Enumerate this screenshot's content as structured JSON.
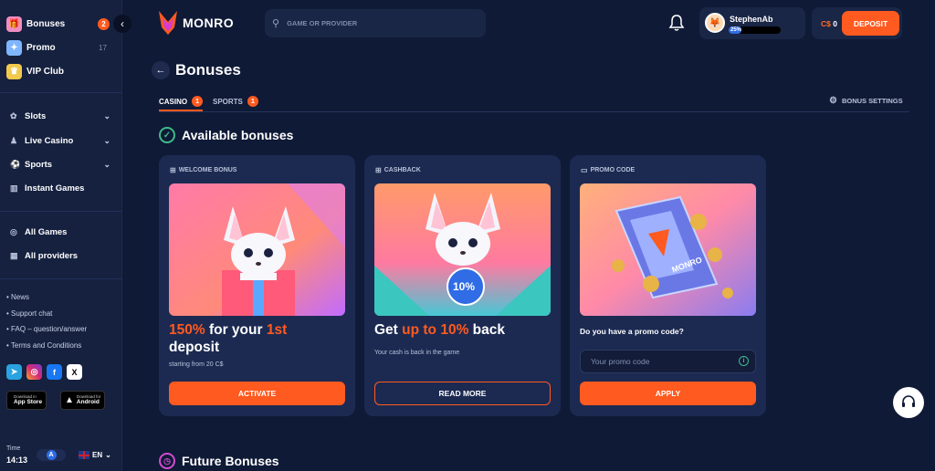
{
  "sidebar": {
    "top_items": [
      {
        "label": "Bonuses",
        "badge": "2",
        "icon": "gift-icon"
      },
      {
        "label": "Promo",
        "count": "17",
        "icon": "promo-icon"
      },
      {
        "label": "VIP Club",
        "icon": "crown-icon"
      }
    ],
    "nav": [
      {
        "label": "Slots",
        "icon": "slots-icon"
      },
      {
        "label": "Live Casino",
        "icon": "live-casino-icon"
      },
      {
        "label": "Sports",
        "icon": "sports-icon"
      },
      {
        "label": "Instant Games",
        "icon": "instant-games-icon"
      }
    ],
    "nav2": [
      {
        "label": "All Games",
        "icon": "all-games-icon"
      },
      {
        "label": "All providers",
        "icon": "providers-icon"
      }
    ],
    "links": [
      "News",
      "Support chat",
      "FAQ – question/answer",
      "Terms and Conditions"
    ],
    "socials": [
      "telegram-icon",
      "instagram-icon",
      "facebook-icon",
      "x-icon"
    ],
    "stores": [
      {
        "small": "Download in",
        "big": "App Store"
      },
      {
        "small": "Download for",
        "big": "Android"
      }
    ],
    "time_label": "Time",
    "time_value": "14:13",
    "theme_letter": "A",
    "language": "EN"
  },
  "header": {
    "logo_text": "MONRO",
    "search_placeholder": "GAME OR PROVIDER",
    "username": "StephenAb",
    "level_percent": "25%",
    "level_fraction": 0.25,
    "balance_currency": "C$",
    "balance_value": "0",
    "deposit_label": "DEPOSIT"
  },
  "page": {
    "title": "Bonuses",
    "tabs": [
      {
        "label": "CASINO",
        "count": "1",
        "active": true
      },
      {
        "label": "SPORTS",
        "count": "1",
        "active": false
      }
    ],
    "settings_label": "BONUS SETTINGS",
    "available_title": "Available bonuses",
    "future_title": "Future Bonuses"
  },
  "cards": [
    {
      "label": "WELCOME BONUS",
      "h_part1": "150%",
      "h_part2": " for your ",
      "h_part3": "1st",
      "h_part4": "deposit",
      "sub": "starting from 20 C$",
      "button": "ACTIVATE"
    },
    {
      "label": "CASHBACK",
      "h_part1": "Get ",
      "h_part2": "up to 10%",
      "h_part3": " back",
      "badge": "10%",
      "sub": "Your cash is back in the game",
      "button": "READ MORE"
    },
    {
      "label": "PROMO CODE",
      "question": "Do you have a promo code?",
      "input_placeholder": "Your promo code",
      "ticket_text": "MONRO",
      "button": "APPLY"
    }
  ],
  "colors": {
    "accent": "#ff5a1f",
    "background": "#0f1a36",
    "card": "#1c2a52",
    "success": "#3fb98a",
    "level_bar": "#2f6ce5"
  }
}
